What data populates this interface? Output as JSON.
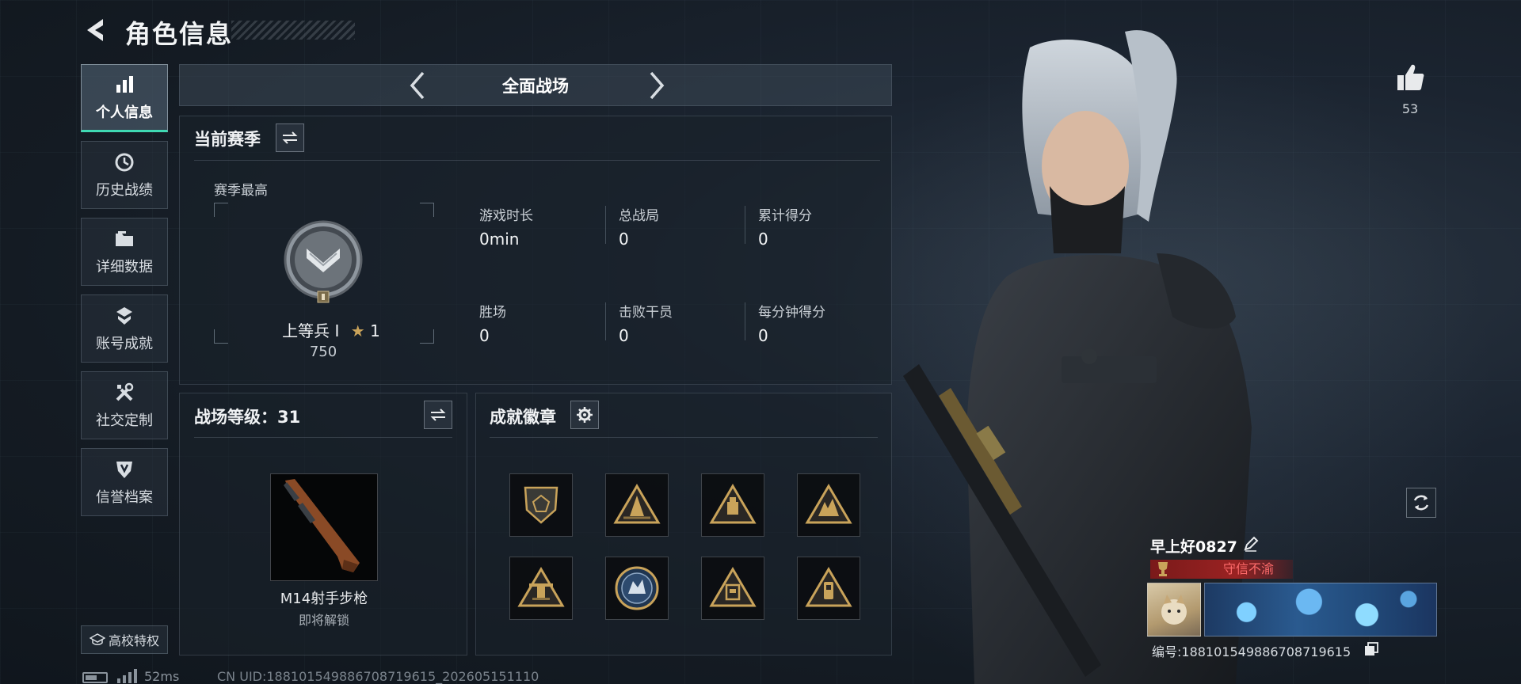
{
  "header": {
    "title": "角色信息"
  },
  "sidebar": {
    "items": [
      {
        "label": "个人信息",
        "icon": "bar-chart-icon",
        "active": true
      },
      {
        "label": "历史战绩",
        "icon": "history-icon",
        "active": false
      },
      {
        "label": "详细数据",
        "icon": "folder-icon",
        "active": false
      },
      {
        "label": "账号成就",
        "icon": "achievement-icon",
        "active": false
      },
      {
        "label": "社交定制",
        "icon": "tools-icon",
        "active": false
      },
      {
        "label": "信誉档案",
        "icon": "shield-icon",
        "active": false
      }
    ],
    "campus_label": "高校特权"
  },
  "mode": {
    "label": "全面战场"
  },
  "season": {
    "title": "当前赛季",
    "best_label": "赛季最高",
    "rank_name": "上等兵 I",
    "rank_stars": "1",
    "rank_score": "750",
    "stats": [
      {
        "label": "游戏时长",
        "value": "0min"
      },
      {
        "label": "总战局",
        "value": "0"
      },
      {
        "label": "累计得分",
        "value": "0"
      },
      {
        "label": "胜场",
        "value": "0"
      },
      {
        "label": "击败干员",
        "value": "0"
      },
      {
        "label": "每分钟得分",
        "value": "0"
      }
    ]
  },
  "battlefield": {
    "title": "战场等级：31",
    "weapon_name": "M14射手步枪",
    "weapon_status": "即将解锁"
  },
  "achievements": {
    "title": "成就徽章",
    "badges": [
      "badge-shield-icon",
      "badge-triangle-icon",
      "badge-triangle-icon",
      "badge-triangle-icon",
      "badge-triangle-icon",
      "badge-circle-icon",
      "badge-triangle-icon",
      "badge-triangle-icon"
    ]
  },
  "profile": {
    "like_count": "53",
    "player_name": "早上好0827",
    "title_text": "守信不渝",
    "player_id": "编号:18810154988670871961​5"
  },
  "footer": {
    "ping": "52ms",
    "uid": "CN UID:18810154988670871961​5_202605151110"
  },
  "colors": {
    "accent": "#3fd9b3",
    "title_red": "#ff6b6b",
    "gold": "#c9a35a"
  }
}
